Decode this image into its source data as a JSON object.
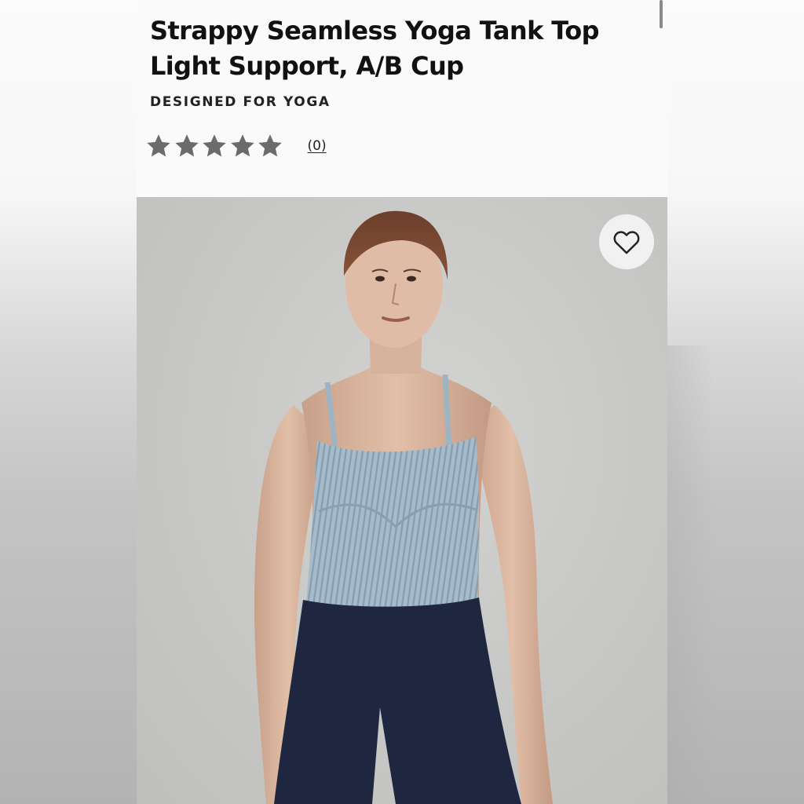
{
  "product": {
    "title_line1": "Strappy Seamless Yoga Tank Top",
    "title_line2": "Light Support, A/B Cup",
    "eyebrow": "DESIGNED FOR YOGA",
    "rating": {
      "stars_filled": 5,
      "stars_total": 5,
      "review_count": "(0)"
    }
  },
  "icons": {
    "star": "star-icon",
    "wishlist": "heart-outline-icon"
  },
  "colors": {
    "star": "#6b6b6b",
    "title": "#111111",
    "tank": "#9fb4c2",
    "leggings": "#1f2740"
  }
}
